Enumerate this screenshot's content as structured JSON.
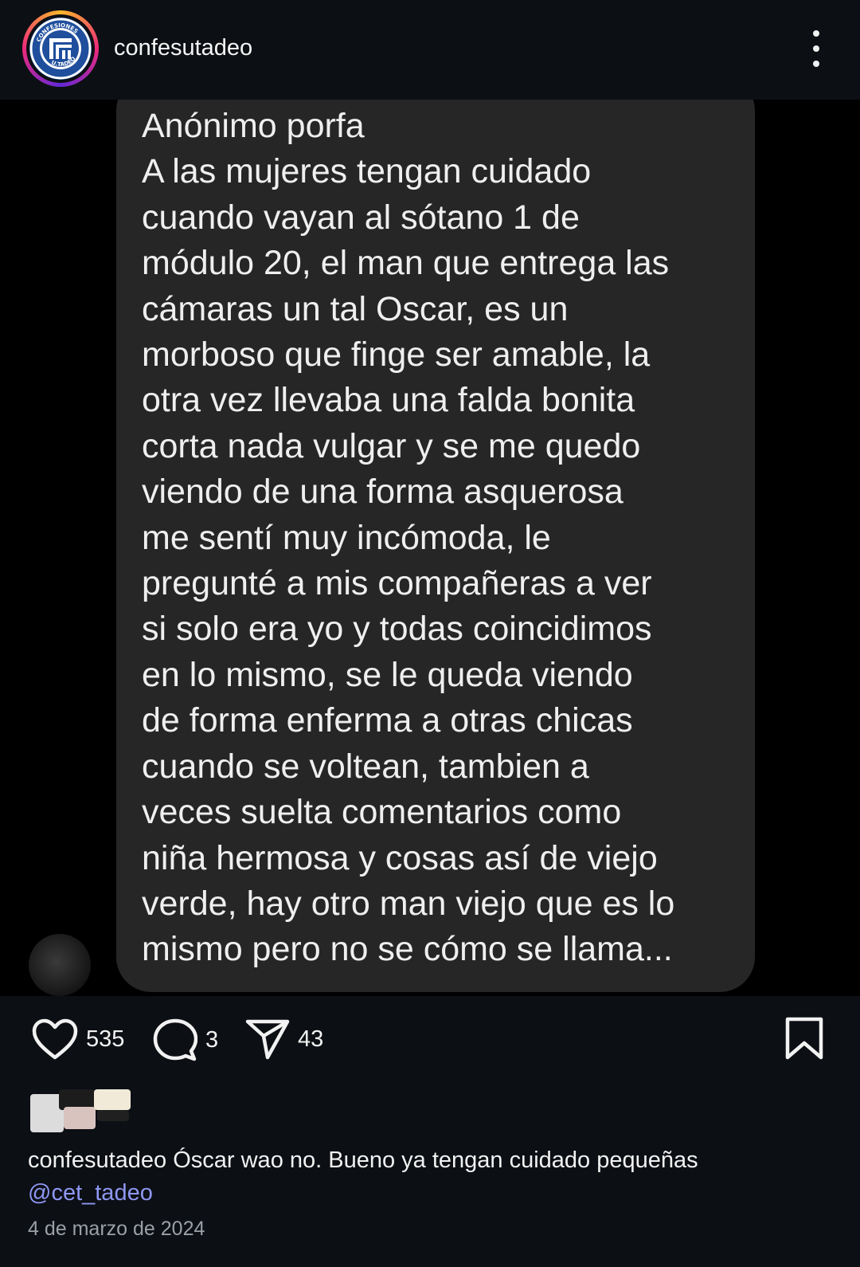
{
  "header": {
    "username": "confesutadeo",
    "avatar_logo_text_top": "CONFESIONES",
    "avatar_logo_text_bottom": "U.TADEO"
  },
  "post": {
    "message_lines": [
      "Anónimo porfa",
      "A las mujeres tengan cuidado",
      "cuando vayan al sótano 1 de",
      "módulo 20, el man que entrega las",
      "cámaras un tal Oscar, es un",
      "morboso que finge ser amable, la",
      "otra vez llevaba una falda bonita",
      "corta nada vulgar y se me quedo",
      "viendo de una forma asquerosa",
      "me sentí muy incómoda, le",
      "pregunté a mis compañeras a ver",
      "si solo era yo y todas coincidimos",
      "en lo mismo, se le queda viendo",
      "de forma enferma a otras chicas",
      "cuando se voltean, tambien a",
      "veces suelta comentarios como",
      "niña hermosa y cosas así de viejo",
      "verde, hay otro man viejo que es lo",
      "mismo pero no se cómo se llama..."
    ]
  },
  "actions": {
    "likes": "535",
    "comments": "3",
    "shares": "43"
  },
  "caption": {
    "username": "confesutadeo",
    "text": "Óscar wao no. Bueno ya tengan cuidado pequeñas",
    "mention": "@cet_tadeo"
  },
  "date": "4 de marzo de 2024",
  "icons": {
    "like": "heart-icon",
    "comment": "comment-bubble-icon",
    "share": "paper-plane-icon",
    "save": "bookmark-icon",
    "more": "more-vertical-icon"
  },
  "colors": {
    "background": "#0c0f14",
    "bubble": "#262626",
    "mention": "#8e97f2",
    "date": "#9aa0a6"
  }
}
